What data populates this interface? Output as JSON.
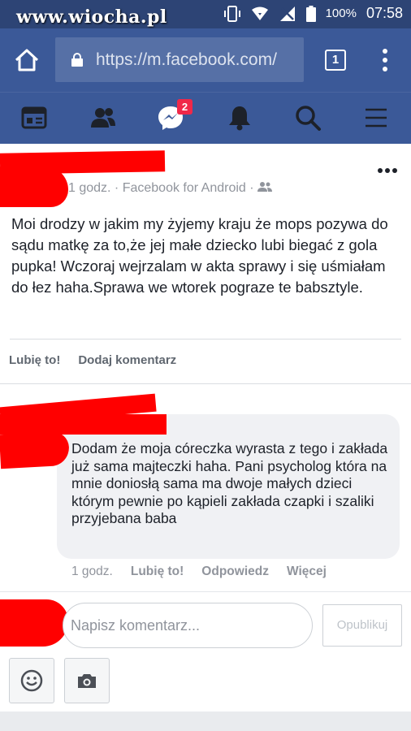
{
  "status_bar": {
    "watermark": "www.wiocha.pl",
    "battery": "100%",
    "time": "07:58"
  },
  "browser": {
    "url": "https://m.facebook.com/",
    "tab_count": "1",
    "icons": [
      "home-icon",
      "lock-icon",
      "tabs-icon",
      "overflow-menu-icon"
    ]
  },
  "fb_nav": {
    "items": [
      "news-feed-icon",
      "friends-icon",
      "messenger-icon",
      "notifications-icon",
      "search-icon",
      "menu-icon"
    ],
    "messenger_badge": "2",
    "colors": {
      "bar": "#3b5998",
      "badge": "#f02849"
    }
  },
  "post": {
    "meta": "1 godz. · Facebook for Android ·",
    "text": "Moi drodzy w jakim my żyjemy kraju że mops pozywa do sądu matkę za to,że jej małe dziecko lubi biegać z gola pupka! Wczoraj wejrzalam w akta sprawy i się uśmiałam do łez haha.Sprawa we wtorek pograze te babsztyle.",
    "actions": {
      "like": "Lubię to!",
      "comment": "Dodaj komentarz"
    }
  },
  "comment": {
    "text": "Dodam że moja córeczka wyrasta z tego i zakłada już sama majteczki haha. Pani psycholog która na mnie doniosłą sama ma dwoje małych dzieci którym pewnie po kąpieli zakłada czapki i szaliki przyjebana baba",
    "time": "1 godz.",
    "like": "Lubię to!",
    "reply": "Odpowiedz",
    "more": "Więcej"
  },
  "composer": {
    "placeholder": "Napisz komentarz...",
    "publish": "Opublikuj",
    "icons": [
      "emoji-icon",
      "camera-icon"
    ]
  },
  "redaction_color": "#ff0000"
}
